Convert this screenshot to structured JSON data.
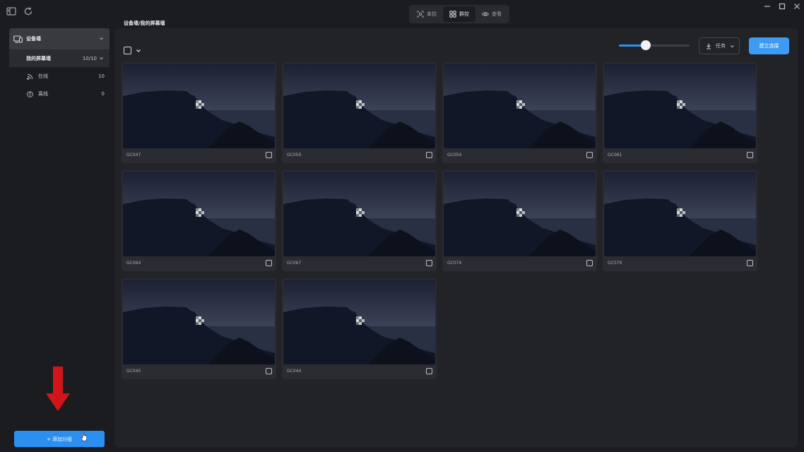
{
  "titlebar": {
    "modes": [
      {
        "label": "单控",
        "icon": "single-control-icon",
        "active": false
      },
      {
        "label": "群控",
        "icon": "group-control-icon",
        "active": true
      },
      {
        "label": "查看",
        "icon": "eye-icon",
        "active": false
      }
    ]
  },
  "sidebar": {
    "header_label": "设备墙",
    "group": {
      "label": "我的屏幕墙",
      "count": "10/10"
    },
    "rows": [
      {
        "label": "在线",
        "count": "10",
        "icon": "rss-online-icon"
      },
      {
        "label": "离线",
        "count": "0",
        "icon": "info-offline-icon"
      }
    ],
    "add_group_label": "+ 添加分组"
  },
  "main": {
    "breadcrumb": "设备墙/我的屏幕墙",
    "task_label": "任务",
    "create_label": "建立连接",
    "zoom_level": 0.38
  },
  "devices": [
    {
      "name": "GC047"
    },
    {
      "name": "GC050"
    },
    {
      "name": "GC054"
    },
    {
      "name": "GC061"
    },
    {
      "name": "GC064"
    },
    {
      "name": "GC067"
    },
    {
      "name": "GC074"
    },
    {
      "name": "GC079"
    },
    {
      "name": "GC045"
    },
    {
      "name": "GC044"
    }
  ],
  "colors": {
    "accent": "#2b8ff2",
    "background": "#1b1c20",
    "panel": "#222327",
    "annotation_arrow": "#d0161b"
  }
}
